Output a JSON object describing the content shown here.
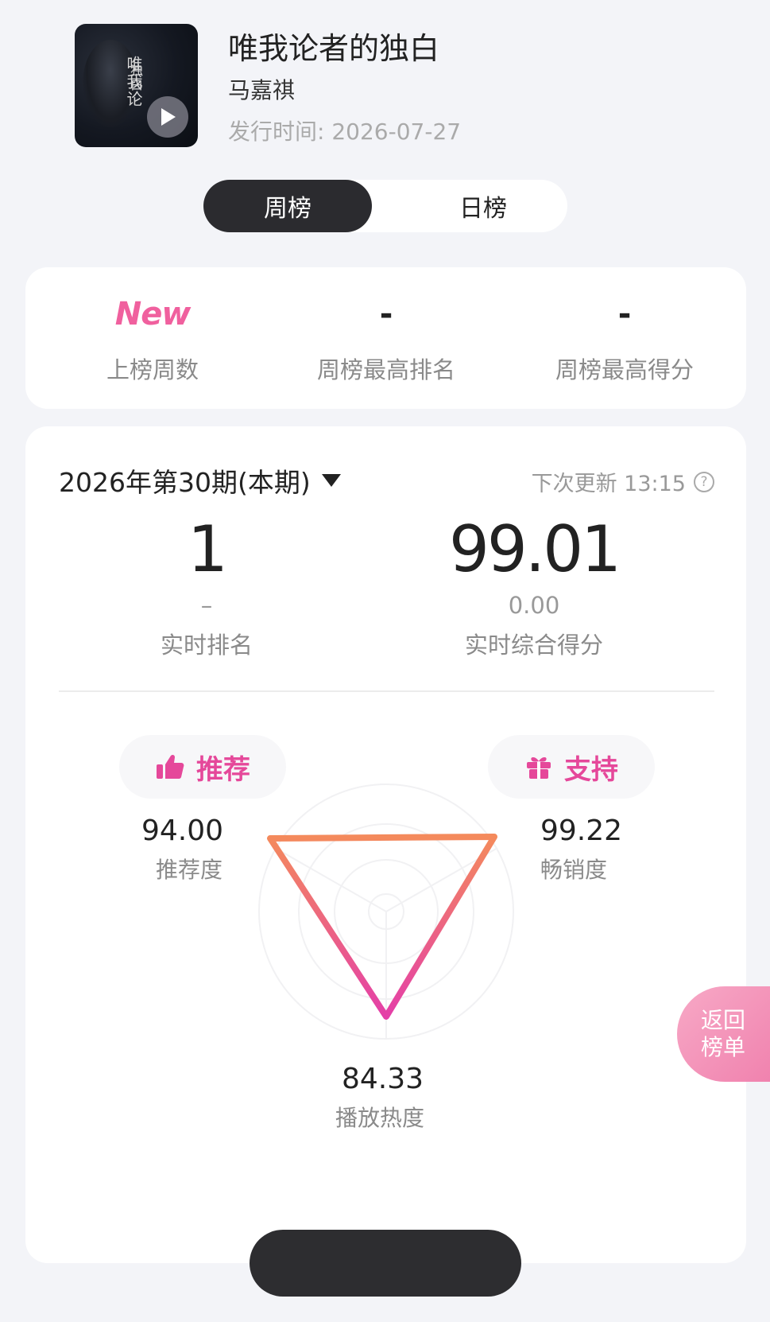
{
  "header": {
    "song_title": "唯我论者的独白",
    "artist": "马嘉祺",
    "release_label": "发行时间:",
    "release_date": "2026-07-27",
    "cover_text_main": "唯我论",
    "cover_text_sub": "独白",
    "play_icon": "play-icon"
  },
  "tabs": [
    {
      "label": "周榜",
      "active": true
    },
    {
      "label": "日榜",
      "active": false
    }
  ],
  "summary": {
    "weeks_value": "New",
    "weeks_label": "上榜周数",
    "best_rank_value": "-",
    "best_rank_label": "周榜最高排名",
    "best_score_value": "-",
    "best_score_label": "周榜最高得分"
  },
  "period": {
    "label": "2026年第30期(本期)",
    "next_update": "下次更新 13:15",
    "help_icon": "?"
  },
  "realtime": {
    "rank_value": "1",
    "rank_change": "–",
    "rank_label": "实时排名",
    "score_value": "99.01",
    "score_change": "0.00",
    "score_label": "实时综合得分"
  },
  "radar": {
    "recommend_pill": "推荐",
    "support_pill": "支持",
    "recommend_value": "94.00",
    "recommend_label": "推荐度",
    "sales_value": "99.22",
    "sales_label": "畅销度",
    "play_value": "84.33",
    "play_label": "播放热度",
    "colors": {
      "accent": "#e5489a",
      "stroke_start": "#f48a5c",
      "stroke_end": "#e43fa8"
    }
  },
  "float_button": {
    "line1": "返回",
    "line2": "榜单"
  }
}
